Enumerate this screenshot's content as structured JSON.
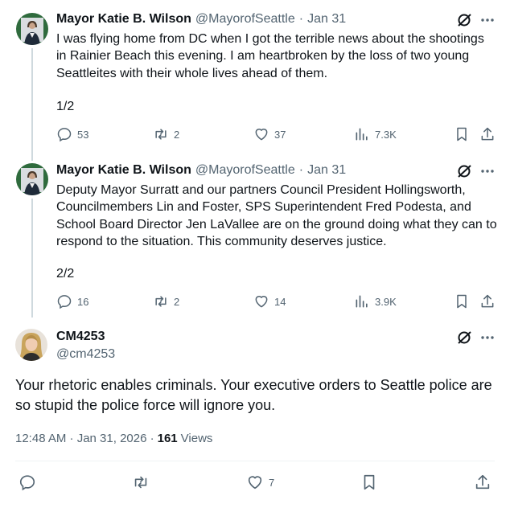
{
  "tweets": [
    {
      "name": "Mayor Katie B. Wilson",
      "handle": "@MayorofSeattle",
      "separator": "·",
      "date": "Jan 31",
      "text": "I was flying home from DC when I got the terrible news about the shootings in Rainier Beach this evening. I am heartbroken by the loss of two young Seattleites with their whole lives ahead of them.",
      "counter": "1/2",
      "replies": "53",
      "reposts": "2",
      "likes": "37",
      "views": "7.3K"
    },
    {
      "name": "Mayor Katie B. Wilson",
      "handle": "@MayorofSeattle",
      "separator": "·",
      "date": "Jan 31",
      "text": "Deputy Mayor Surratt and our partners Council President Hollingsworth, Councilmembers Lin and Foster, SPS Superintendent Fred Podesta, and School Board Director Jen LaVallee are on the ground doing what they can to respond to the situation. This community deserves justice.",
      "counter": "2/2",
      "replies": "16",
      "reposts": "2",
      "likes": "14",
      "views": "3.9K"
    }
  ],
  "reply": {
    "name": "CM4253",
    "handle": "@cm4253",
    "text": "Your rhetoric enables criminals. Your executive orders to Seattle police are so stupid the police force will ignore you.",
    "timestamp": "12:48 AM · Jan 31, 2026 ·",
    "views_count": "161",
    "views_label": "Views",
    "likes": "7"
  },
  "icons": {
    "reply": "reply-icon",
    "repost": "repost-icon",
    "like": "heart-icon",
    "views": "analytics-icon",
    "bookmark": "bookmark-icon",
    "share": "share-icon",
    "grok": "grok-icon",
    "more": "more-icon"
  },
  "colors": {
    "text": "#0f1419",
    "secondary": "#536471",
    "thread_line": "#cfd9de"
  }
}
